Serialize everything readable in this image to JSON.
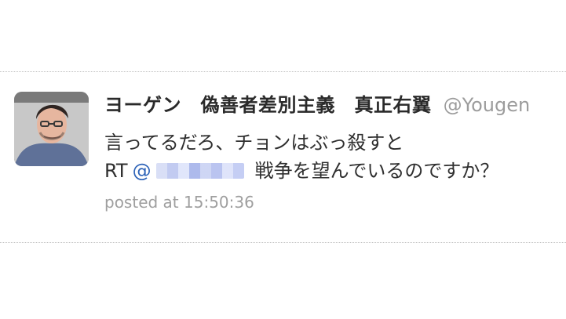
{
  "tweet": {
    "avatar_icon": "person-avatar",
    "display_name": "ヨーゲン　偽善者差別主義　真正右翼",
    "handle": "@Yougen",
    "text_line1": "言ってるだろ、チョンはぶっ殺すと",
    "rt_label": "RT",
    "mention_at": "@",
    "rt_text": "戦争を望んでいるのですか？",
    "posted_prefix": "posted at ",
    "posted_time": "15:50:36"
  },
  "colors": {
    "mention": "#2d63b8",
    "meta": "#9f9f9f",
    "divider": "#bdbdbd"
  }
}
